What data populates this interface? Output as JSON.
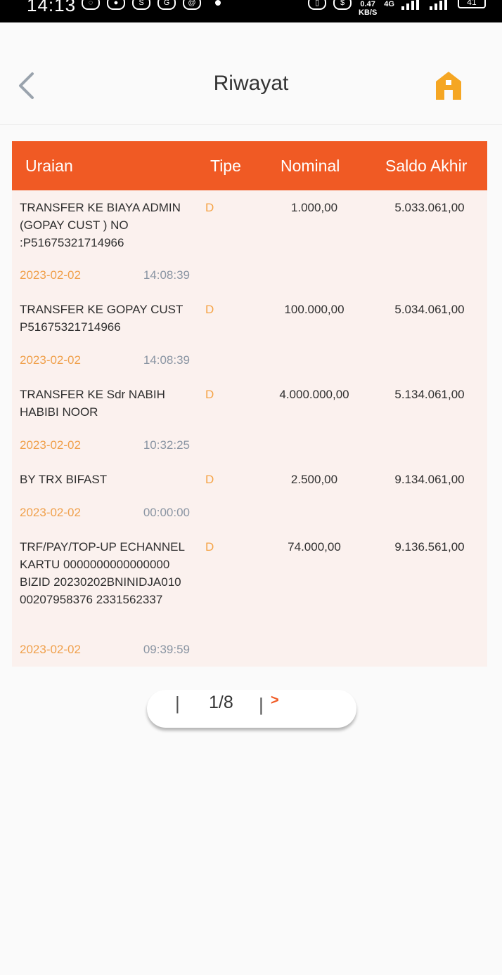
{
  "status_bar": {
    "time": "14:13",
    "speed": "0.47",
    "speed_unit": "KB/S",
    "network": "4G",
    "battery": "41"
  },
  "header": {
    "title": "Riwayat"
  },
  "table": {
    "columns": [
      "Uraian",
      "Tipe",
      "Nominal",
      "Saldo Akhir"
    ],
    "rows": [
      {
        "uraian": "TRANSFER KE BIAYA ADMIN (GOPAY CUST ) NO :P51675321714966",
        "tipe": "D",
        "nominal": "1.000,00",
        "saldo": "5.033.061,00",
        "date": "2023-02-02",
        "time": "14:08:39"
      },
      {
        "uraian": "TRANSFER KE GOPAY CUST P51675321714966",
        "tipe": "D",
        "nominal": "100.000,00",
        "saldo": "5.034.061,00",
        "date": "2023-02-02",
        "time": "14:08:39"
      },
      {
        "uraian": "TRANSFER KE Sdr NABIH HABIBI NOOR",
        "tipe": "D",
        "nominal": "4.000.000,00",
        "saldo": "5.134.061,00",
        "date": "2023-02-02",
        "time": "10:32:25"
      },
      {
        "uraian": "BY TRX BIFAST",
        "tipe": "D",
        "nominal": "2.500,00",
        "saldo": "9.134.061,00",
        "date": "2023-02-02",
        "time": "00:00:00"
      },
      {
        "uraian": "TRF/PAY/TOP-UP ECHANNEL KARTU 0000000000000000 BIZID 20230202BNINIDJA010 00207958376 2331562337",
        "tipe": "D",
        "nominal": "74.000,00",
        "saldo": "9.136.561,00",
        "date": "2023-02-02",
        "time": "09:39:59"
      }
    ]
  },
  "pagination": {
    "separator": "|",
    "label": "1/8",
    "next": ">"
  },
  "colors": {
    "accent": "#f05a24",
    "date": "#f0a04b",
    "home_icon": "#f5a623",
    "row_bg": "#fbf1ee"
  },
  "icons": {
    "back": "chevron-left-icon",
    "home": "home-icon"
  }
}
